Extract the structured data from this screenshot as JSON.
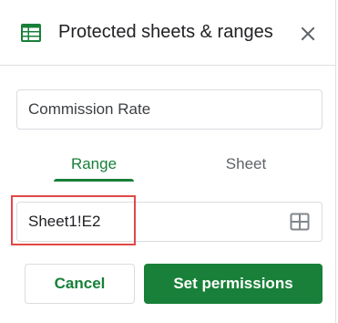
{
  "header": {
    "icon": "sheets-icon",
    "title": "Protected sheets & ranges",
    "close_icon": "close-icon"
  },
  "description": {
    "value": "Commission Rate"
  },
  "tabs": [
    {
      "label": "Range",
      "active": true
    },
    {
      "label": "Sheet",
      "active": false
    }
  ],
  "range": {
    "value": "Sheet1!E2",
    "grid_icon": "grid-select-icon",
    "highlighted": true
  },
  "buttons": {
    "cancel_label": "Cancel",
    "set_label": "Set permissions"
  },
  "colors": {
    "accent": "#188038",
    "highlight": "#e04848",
    "border": "#dadce0"
  }
}
